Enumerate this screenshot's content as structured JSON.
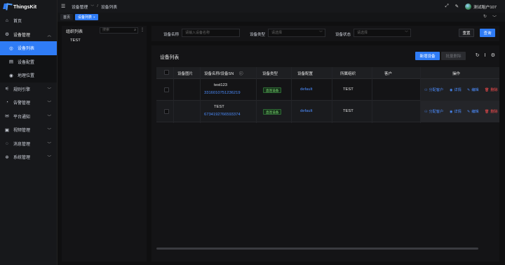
{
  "app": {
    "name": "ThingsKit"
  },
  "sidebar": {
    "items": [
      {
        "label": "首页",
        "icon": "home-icon"
      },
      {
        "label": "设备管理",
        "icon": "device-icon",
        "open": true
      },
      {
        "label": "设备列表",
        "icon": "list-icon",
        "sub": true,
        "active": true
      },
      {
        "label": "设备配置",
        "icon": "config-icon",
        "sub": true
      },
      {
        "label": "地理位置",
        "icon": "location-icon",
        "sub": true
      },
      {
        "label": "规则引擎",
        "icon": "rule-icon"
      },
      {
        "label": "告警管理",
        "icon": "alarm-icon"
      },
      {
        "label": "平台通知",
        "icon": "notice-icon"
      },
      {
        "label": "视频管理",
        "icon": "video-icon"
      },
      {
        "label": "消息管理",
        "icon": "message-icon"
      },
      {
        "label": "系统管理",
        "icon": "settings-icon"
      }
    ]
  },
  "header": {
    "breadcrumb": [
      "设备管理",
      "设备列表"
    ],
    "breadcrumb_sep": "/",
    "user": "测试租户107"
  },
  "tabs": [
    {
      "label": "首页",
      "active": false
    },
    {
      "label": "设备列表",
      "active": true
    }
  ],
  "org": {
    "title": "组织列表",
    "search_placeholder": "搜索",
    "nodes": [
      "TEST"
    ]
  },
  "filter": {
    "name_label": "设备名称",
    "name_placeholder": "请输入设备名称",
    "type_label": "设备类型",
    "type_placeholder": "请选择",
    "status_label": "设备状态",
    "status_placeholder": "请选择",
    "reset": "重置",
    "query": "查询"
  },
  "list": {
    "title": "设备列表",
    "add": "新增设备",
    "batch_delete": "批量删除",
    "columns": [
      "设备图片",
      "设备名称/设备SN",
      "设备类型",
      "设备配置",
      "所属组织",
      "客户",
      "操作"
    ],
    "rows": [
      {
        "name": "test123",
        "sn": "3316010751236219",
        "type": "直连设备",
        "config": "default",
        "org": "TEST",
        "customer": ""
      },
      {
        "name": "TEST",
        "sn": "6734192766593374",
        "type": "直连设备",
        "config": "default",
        "org": "TEST",
        "customer": ""
      }
    ],
    "actions": {
      "assign": "分配客户",
      "detail": "详情",
      "edit": "编辑",
      "delete": "删除"
    }
  },
  "colors": {
    "accent": "#2f7cf6",
    "link": "#4c8dff",
    "danger": "#ff4d4f",
    "tag_green": "#7fdc74"
  }
}
